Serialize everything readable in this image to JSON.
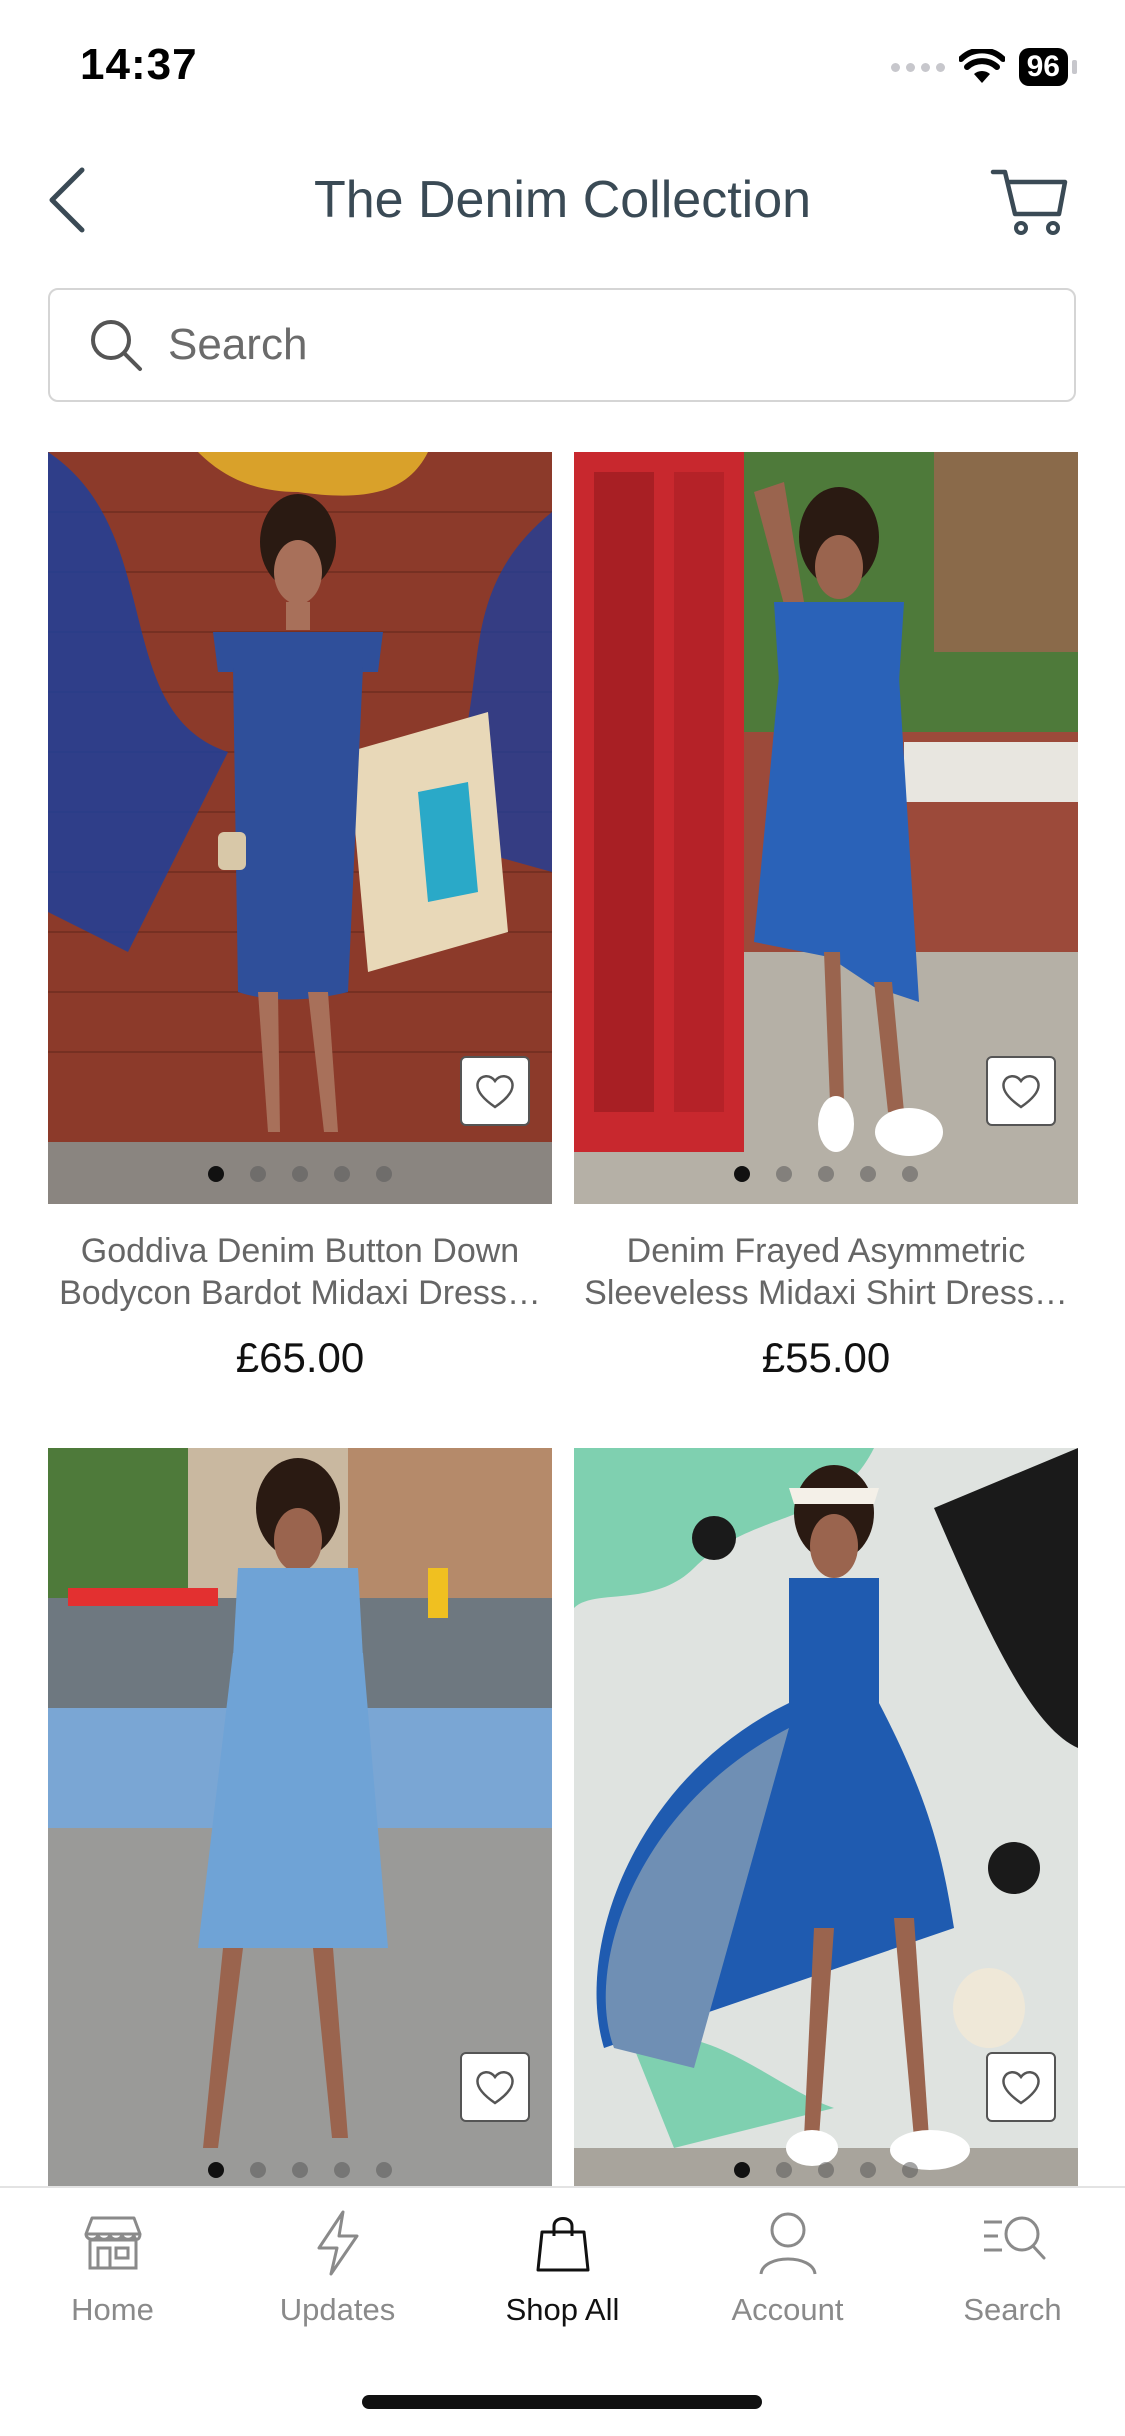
{
  "status_bar": {
    "time": "14:37",
    "battery": "96"
  },
  "header": {
    "title": "The Denim Collection"
  },
  "search": {
    "placeholder": "Search"
  },
  "products": [
    {
      "name": "Goddiva Denim Button Down Bodycon Bardot Midaxi Dress…",
      "price": "£65.00",
      "dress_color": "#2f4f9a",
      "bg_color": "#8c3a2a",
      "active_dot": 0
    },
    {
      "name": "Denim Frayed Asymmetric Sleeveless Midaxi Shirt Dress…",
      "price": "£55.00",
      "dress_color": "#2a62b8",
      "bg_color": "#c8282e",
      "active_dot": 0
    },
    {
      "name": "",
      "price": "",
      "dress_color": "#6fa3d6",
      "bg_color": "#7b8a96",
      "active_dot": 0
    },
    {
      "name": "",
      "price": "",
      "dress_color": "#1f5bb0",
      "bg_color": "#dfe3e0",
      "active_dot": 0
    }
  ],
  "tabs": [
    {
      "label": "Home",
      "icon": "shop-front-icon"
    },
    {
      "label": "Updates",
      "icon": "lightning-icon"
    },
    {
      "label": "Shop All",
      "icon": "shopping-bag-icon"
    },
    {
      "label": "Account",
      "icon": "person-icon"
    },
    {
      "label": "Search",
      "icon": "search-list-icon"
    }
  ],
  "active_tab": "Shop All"
}
